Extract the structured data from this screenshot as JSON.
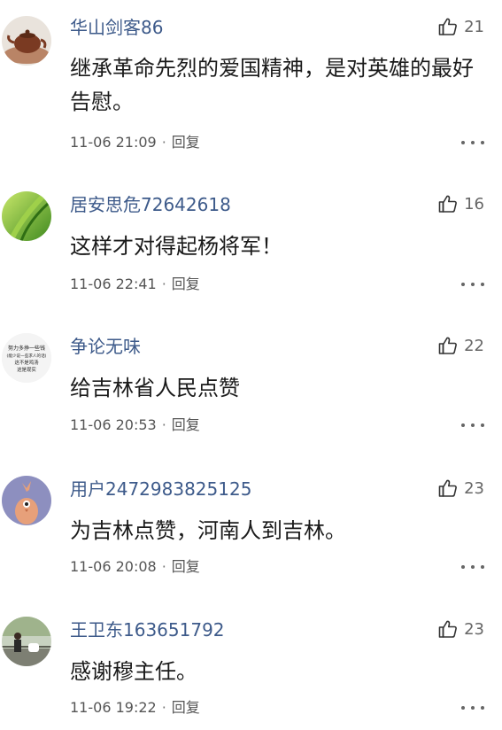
{
  "comments": [
    {
      "user": "华山剑客86",
      "avatar_icon": "teapot-avatar-icon",
      "likes": "21",
      "text": "继承革命先烈的爱国精神，是对英雄的最好告慰。",
      "time": "11-06 21:09",
      "reply_label": "回复"
    },
    {
      "user": "居安思危72642618",
      "avatar_icon": "green-leaf-avatar-icon",
      "likes": "16",
      "text": "这样才对得起杨将军！",
      "time": "11-06 22:41",
      "reply_label": "回复"
    },
    {
      "user": "争论无味",
      "avatar_icon": "text-motto-avatar",
      "avatar_text": [
        "努力多挣一些钱",
        "(能少说一些求人的话)",
        "这不是鸡汤",
        "这是现实"
      ],
      "likes": "22",
      "text": "给吉林省人民点赞",
      "time": "11-06 20:53",
      "reply_label": "回复"
    },
    {
      "user": "用户2472983825125",
      "avatar_icon": "cartoon-bird-avatar-icon",
      "likes": "23",
      "text": "为吉林点赞，河南人到吉林。",
      "time": "11-06 20:08",
      "reply_label": "回复"
    },
    {
      "user": "王卫东163651792",
      "avatar_icon": "person-photo-avatar-icon",
      "likes": "23",
      "text": "感谢穆主任。",
      "time": "11-06 19:22",
      "reply_label": "回复"
    }
  ],
  "separator": "·",
  "colors": {
    "username": "#3d5a8a",
    "text": "#1a1a1a",
    "meta": "#555555"
  }
}
